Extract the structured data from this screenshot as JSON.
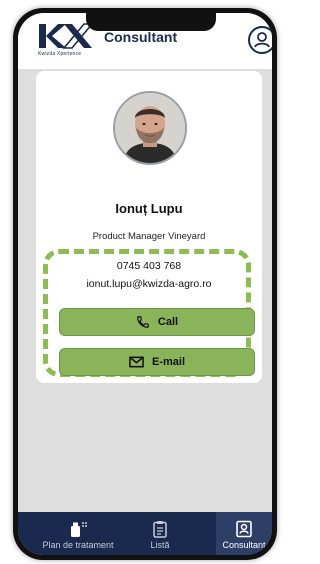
{
  "header": {
    "logo_text": "Kwizda Xperience",
    "title": "Consultant",
    "icons": {
      "profile": "user-circle-icon"
    }
  },
  "consultant": {
    "name": "Ionuț Lupu",
    "role": "Product Manager Vineyard",
    "phone": "0745 403 768",
    "email": "ionut.lupu@kwizda-agro.ro",
    "call_label": "Call",
    "email_label": "E-mail",
    "icons": {
      "call": "phone-icon",
      "email": "envelope-icon"
    }
  },
  "nav": {
    "items": [
      {
        "label": "Plan de tratament",
        "icon": "sprayer-icon"
      },
      {
        "label": "Listă",
        "icon": "clipboard-list-icon"
      },
      {
        "label": "Consultant",
        "icon": "contact-card-icon",
        "active": true
      }
    ]
  },
  "colors": {
    "brand_navy": "#1a2a4f",
    "accent_green": "#8ab45a",
    "highlight_dash": "#8dbd4f",
    "background": "#dedede"
  }
}
